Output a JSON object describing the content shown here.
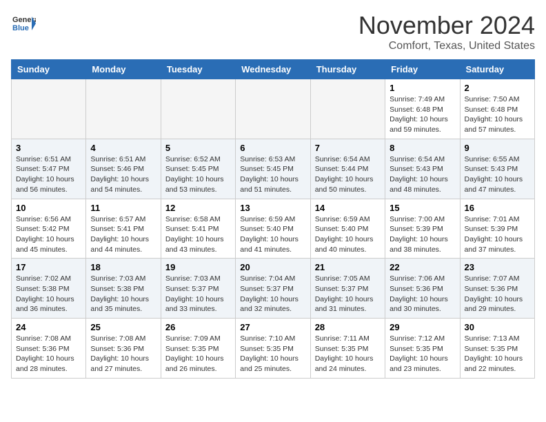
{
  "header": {
    "logo_general": "General",
    "logo_blue": "Blue",
    "month_title": "November 2024",
    "location": "Comfort, Texas, United States"
  },
  "weekdays": [
    "Sunday",
    "Monday",
    "Tuesday",
    "Wednesday",
    "Thursday",
    "Friday",
    "Saturday"
  ],
  "weeks": [
    [
      {
        "day": "",
        "info": ""
      },
      {
        "day": "",
        "info": ""
      },
      {
        "day": "",
        "info": ""
      },
      {
        "day": "",
        "info": ""
      },
      {
        "day": "",
        "info": ""
      },
      {
        "day": "1",
        "info": "Sunrise: 7:49 AM\nSunset: 6:48 PM\nDaylight: 10 hours\nand 59 minutes."
      },
      {
        "day": "2",
        "info": "Sunrise: 7:50 AM\nSunset: 6:48 PM\nDaylight: 10 hours\nand 57 minutes."
      }
    ],
    [
      {
        "day": "3",
        "info": "Sunrise: 6:51 AM\nSunset: 5:47 PM\nDaylight: 10 hours\nand 56 minutes."
      },
      {
        "day": "4",
        "info": "Sunrise: 6:51 AM\nSunset: 5:46 PM\nDaylight: 10 hours\nand 54 minutes."
      },
      {
        "day": "5",
        "info": "Sunrise: 6:52 AM\nSunset: 5:45 PM\nDaylight: 10 hours\nand 53 minutes."
      },
      {
        "day": "6",
        "info": "Sunrise: 6:53 AM\nSunset: 5:45 PM\nDaylight: 10 hours\nand 51 minutes."
      },
      {
        "day": "7",
        "info": "Sunrise: 6:54 AM\nSunset: 5:44 PM\nDaylight: 10 hours\nand 50 minutes."
      },
      {
        "day": "8",
        "info": "Sunrise: 6:54 AM\nSunset: 5:43 PM\nDaylight: 10 hours\nand 48 minutes."
      },
      {
        "day": "9",
        "info": "Sunrise: 6:55 AM\nSunset: 5:43 PM\nDaylight: 10 hours\nand 47 minutes."
      }
    ],
    [
      {
        "day": "10",
        "info": "Sunrise: 6:56 AM\nSunset: 5:42 PM\nDaylight: 10 hours\nand 45 minutes."
      },
      {
        "day": "11",
        "info": "Sunrise: 6:57 AM\nSunset: 5:41 PM\nDaylight: 10 hours\nand 44 minutes."
      },
      {
        "day": "12",
        "info": "Sunrise: 6:58 AM\nSunset: 5:41 PM\nDaylight: 10 hours\nand 43 minutes."
      },
      {
        "day": "13",
        "info": "Sunrise: 6:59 AM\nSunset: 5:40 PM\nDaylight: 10 hours\nand 41 minutes."
      },
      {
        "day": "14",
        "info": "Sunrise: 6:59 AM\nSunset: 5:40 PM\nDaylight: 10 hours\nand 40 minutes."
      },
      {
        "day": "15",
        "info": "Sunrise: 7:00 AM\nSunset: 5:39 PM\nDaylight: 10 hours\nand 38 minutes."
      },
      {
        "day": "16",
        "info": "Sunrise: 7:01 AM\nSunset: 5:39 PM\nDaylight: 10 hours\nand 37 minutes."
      }
    ],
    [
      {
        "day": "17",
        "info": "Sunrise: 7:02 AM\nSunset: 5:38 PM\nDaylight: 10 hours\nand 36 minutes."
      },
      {
        "day": "18",
        "info": "Sunrise: 7:03 AM\nSunset: 5:38 PM\nDaylight: 10 hours\nand 35 minutes."
      },
      {
        "day": "19",
        "info": "Sunrise: 7:03 AM\nSunset: 5:37 PM\nDaylight: 10 hours\nand 33 minutes."
      },
      {
        "day": "20",
        "info": "Sunrise: 7:04 AM\nSunset: 5:37 PM\nDaylight: 10 hours\nand 32 minutes."
      },
      {
        "day": "21",
        "info": "Sunrise: 7:05 AM\nSunset: 5:37 PM\nDaylight: 10 hours\nand 31 minutes."
      },
      {
        "day": "22",
        "info": "Sunrise: 7:06 AM\nSunset: 5:36 PM\nDaylight: 10 hours\nand 30 minutes."
      },
      {
        "day": "23",
        "info": "Sunrise: 7:07 AM\nSunset: 5:36 PM\nDaylight: 10 hours\nand 29 minutes."
      }
    ],
    [
      {
        "day": "24",
        "info": "Sunrise: 7:08 AM\nSunset: 5:36 PM\nDaylight: 10 hours\nand 28 minutes."
      },
      {
        "day": "25",
        "info": "Sunrise: 7:08 AM\nSunset: 5:36 PM\nDaylight: 10 hours\nand 27 minutes."
      },
      {
        "day": "26",
        "info": "Sunrise: 7:09 AM\nSunset: 5:35 PM\nDaylight: 10 hours\nand 26 minutes."
      },
      {
        "day": "27",
        "info": "Sunrise: 7:10 AM\nSunset: 5:35 PM\nDaylight: 10 hours\nand 25 minutes."
      },
      {
        "day": "28",
        "info": "Sunrise: 7:11 AM\nSunset: 5:35 PM\nDaylight: 10 hours\nand 24 minutes."
      },
      {
        "day": "29",
        "info": "Sunrise: 7:12 AM\nSunset: 5:35 PM\nDaylight: 10 hours\nand 23 minutes."
      },
      {
        "day": "30",
        "info": "Sunrise: 7:13 AM\nSunset: 5:35 PM\nDaylight: 10 hours\nand 22 minutes."
      }
    ]
  ]
}
